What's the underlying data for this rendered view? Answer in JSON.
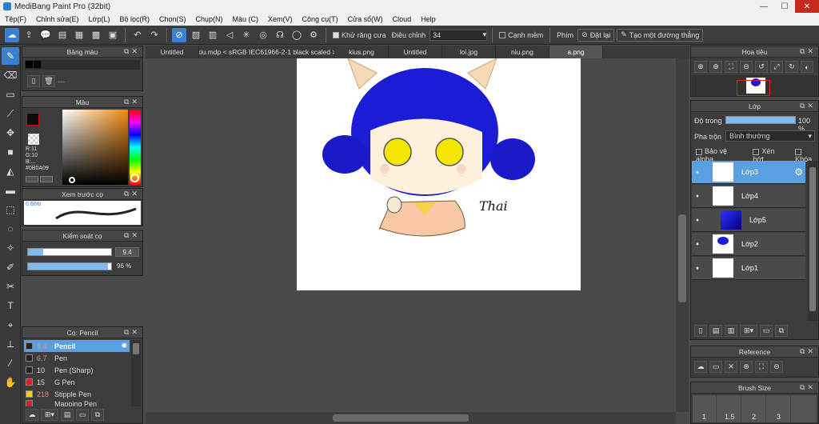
{
  "window": {
    "title": "MediBang Paint Pro (32bit)",
    "minimize": "—",
    "maximize": "☐",
    "close": "✕"
  },
  "menu": [
    "Tệp(F)",
    "Chỉnh sửa(E)",
    "Lớp(L)",
    "Bộ lọc(R)",
    "Chọn(S)",
    "Chụp(N)",
    "Màu (C)",
    "Xem(V)",
    "Công cụ(T)",
    "Cửa sổ(W)",
    "Cloud",
    "Help"
  ],
  "toolbar": {
    "antialias_label": "Khử răng cưa",
    "adjust_label": "Điều chỉnh",
    "adjust_value": "34",
    "edge_label": "Cạnh mềm",
    "key_label": "Phím",
    "reset_label": "Đặt lại",
    "straight_label": "Tạo một đường thẳng"
  },
  "tabs": [
    "Untitled",
    "kiu.mdp < sRGB IEC61966-2-1 black scaled >",
    "kius.png",
    "Untitled",
    "loi.jpg",
    "niu.png",
    "a.png"
  ],
  "palette_panel": {
    "title": "Bảng màu",
    "dash": "---"
  },
  "color_panel": {
    "title": "Màu",
    "r": "R:11",
    "g": "G:10",
    "b": "B:...",
    "hex": "#0B0A09"
  },
  "brush_preview": {
    "title": "Xem trước cọ",
    "size": "0.60m"
  },
  "brush_control": {
    "title": "Kiểm soát cọ",
    "size_value": "9.4",
    "opacity_value": "96 %",
    "size_frac": 0.18,
    "opacity_frac": 0.96
  },
  "brush_list": {
    "title": "Cọ: Pencil",
    "items": [
      {
        "size": "9.4",
        "name": "Pencil",
        "color": "#222222"
      },
      {
        "size": "6.7",
        "name": "Pen",
        "color": "#222222"
      },
      {
        "size": "10",
        "name": "Pen (Sharp)",
        "color": "#222222"
      },
      {
        "size": "15",
        "name": "G Pen",
        "color": "#e02020"
      },
      {
        "size": "218",
        "name": "Stipple Pen",
        "color": "#f0d000"
      },
      {
        "size": "",
        "name": "Mapping Pen",
        "color": "#e02020"
      }
    ]
  },
  "navigator": {
    "title": "Hoa tiêu"
  },
  "layer_panel": {
    "title": "Lớp",
    "opacity_label": "Độ trong",
    "opacity_value": "100 %",
    "blend_label": "Pha trộn",
    "blend_value": "Bình thường",
    "protect_alpha": "Bảo vệ alpha",
    "clipping": "Xén bớt",
    "lock": "Khóa",
    "layers": [
      "Lớp3",
      "Lớp4",
      "Lớp5",
      "Lớp2",
      "Lớp1"
    ]
  },
  "reference_panel": {
    "title": "Reference"
  },
  "brush_size_panel": {
    "title": "Brush Size",
    "sizes": [
      "1",
      "1.5",
      "2",
      "3"
    ]
  },
  "canvas": {
    "signature": "Thai"
  },
  "colors": {
    "accent": "#3a7fd0",
    "hair": "#1a1ad0",
    "eyes": "#f5e600",
    "skin": "#fdf1dc"
  }
}
